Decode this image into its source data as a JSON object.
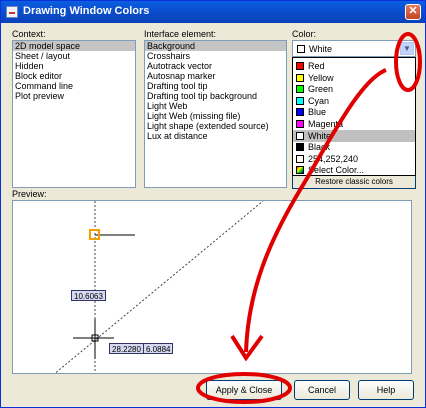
{
  "window": {
    "title": "Drawing Window Colors"
  },
  "context": {
    "label": "Context:",
    "items": [
      "2D model space",
      "Sheet / layout",
      "Hidden",
      "Block editor",
      "Command line",
      "Plot preview"
    ],
    "selected": 0
  },
  "interface": {
    "label": "Interface element:",
    "items": [
      "Background",
      "Crosshairs",
      "Autotrack vector",
      "Autosnap marker",
      "Drafting tool tip",
      "Drafting tool tip background",
      "Light Web",
      "Light Web (missing file)",
      "Light shape (extended source)",
      "Lux at distance"
    ],
    "selected": 0
  },
  "color": {
    "label": "Color:",
    "current": "White",
    "options": [
      {
        "label": "Red",
        "swatch": "#ff0000"
      },
      {
        "label": "Yellow",
        "swatch": "#ffff00"
      },
      {
        "label": "Green",
        "swatch": "#00ff00"
      },
      {
        "label": "Cyan",
        "swatch": "#00ffff"
      },
      {
        "label": "Blue",
        "swatch": "#0000ff"
      },
      {
        "label": "Magenta",
        "swatch": "#ff00ff"
      },
      {
        "label": "White",
        "swatch": "#ffffff"
      },
      {
        "label": "Black",
        "swatch": "#000000"
      },
      {
        "label": "254,252,240",
        "swatch": "#fefcf0"
      },
      {
        "label": "Select Color...",
        "swatch": "multicolor-icon"
      }
    ],
    "highlighted": 6
  },
  "restore": {
    "label": "Restore classic colors"
  },
  "preview": {
    "label": "Preview:",
    "tooltip_main": "10.6063",
    "tooltip_x": "28.2280",
    "tooltip_y": "6.0884"
  },
  "buttons": {
    "apply": "Apply & Close",
    "cancel": "Cancel",
    "help": "Help"
  },
  "colors": {
    "annotation": "#e00000",
    "titlebar": "#0a5fe0",
    "marker": "#f0a000"
  }
}
